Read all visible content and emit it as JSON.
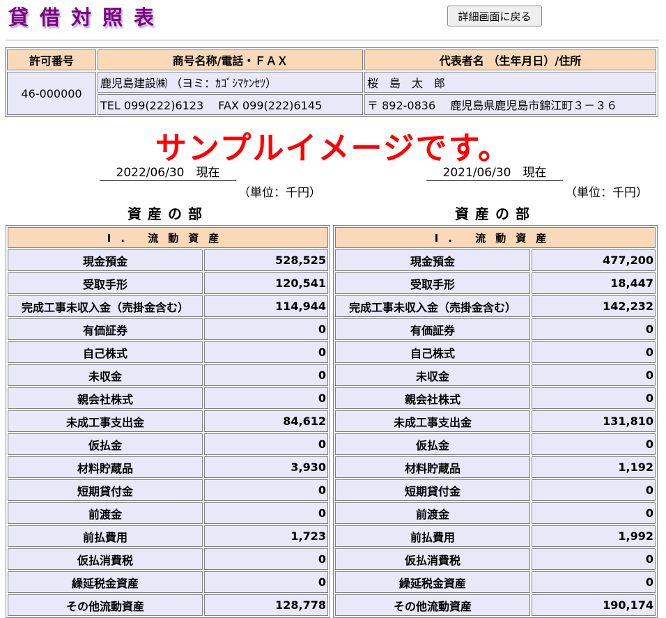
{
  "page": {
    "title": "貸借対照表",
    "back_button": "詳細画面に戻る",
    "sample_notice": "サンプルイメージです。"
  },
  "company": {
    "headers": {
      "license": "許可番号",
      "name": "商号名称/電話・ＦＡＸ",
      "rep": "代表者名 （生年月日）/住所"
    },
    "license_no": "46-000000",
    "name": "鹿児島建設㈱ （ヨミ：ｶｺﾞｼﾏｹﾝｾﾂ）",
    "phone_fax": "TEL 099(222)6123　 FAX 099(222)6145",
    "representative": "桜　島　太　郎",
    "address": "〒 892-0836　 鹿児島県鹿児島市錦江町３－３６"
  },
  "periods": [
    {
      "date": "2022/06/30　現在",
      "unit": "（単位：千円）",
      "section": "資産の部",
      "category": "I. 流動資産",
      "rows": [
        {
          "label": "現金預金",
          "value": "528,525"
        },
        {
          "label": "受取手形",
          "value": "120,541"
        },
        {
          "label": "完成工事未収入金（売掛金含む）",
          "value": "114,944"
        },
        {
          "label": "有価証券",
          "value": "0"
        },
        {
          "label": "自己株式",
          "value": "0"
        },
        {
          "label": "未収金",
          "value": "0"
        },
        {
          "label": "親会社株式",
          "value": "0"
        },
        {
          "label": "未成工事支出金",
          "value": "84,612"
        },
        {
          "label": "仮払金",
          "value": "0"
        },
        {
          "label": "材料貯蔵品",
          "value": "3,930"
        },
        {
          "label": "短期貸付金",
          "value": "0"
        },
        {
          "label": "前渡金",
          "value": "0"
        },
        {
          "label": "前払費用",
          "value": "1,723"
        },
        {
          "label": "仮払消費税",
          "value": "0"
        },
        {
          "label": "繰延税金資産",
          "value": "0"
        },
        {
          "label": "その他流動資産",
          "value": "128,778"
        }
      ]
    },
    {
      "date": "2021/06/30　現在",
      "unit": "（単位：千円）",
      "section": "資産の部",
      "category": "I. 流動資産",
      "rows": [
        {
          "label": "現金預金",
          "value": "477,200"
        },
        {
          "label": "受取手形",
          "value": "18,447"
        },
        {
          "label": "完成工事未収入金（売掛金含む）",
          "value": "142,232"
        },
        {
          "label": "有価証券",
          "value": "0"
        },
        {
          "label": "自己株式",
          "value": "0"
        },
        {
          "label": "未収金",
          "value": "0"
        },
        {
          "label": "親会社株式",
          "value": "0"
        },
        {
          "label": "未成工事支出金",
          "value": "131,810"
        },
        {
          "label": "仮払金",
          "value": "0"
        },
        {
          "label": "材料貯蔵品",
          "value": "1,192"
        },
        {
          "label": "短期貸付金",
          "value": "0"
        },
        {
          "label": "前渡金",
          "value": "0"
        },
        {
          "label": "前払費用",
          "value": "1,992"
        },
        {
          "label": "仮払消費税",
          "value": "0"
        },
        {
          "label": "繰延税金資産",
          "value": "0"
        },
        {
          "label": "その他流動資産",
          "value": "190,174"
        }
      ]
    }
  ]
}
